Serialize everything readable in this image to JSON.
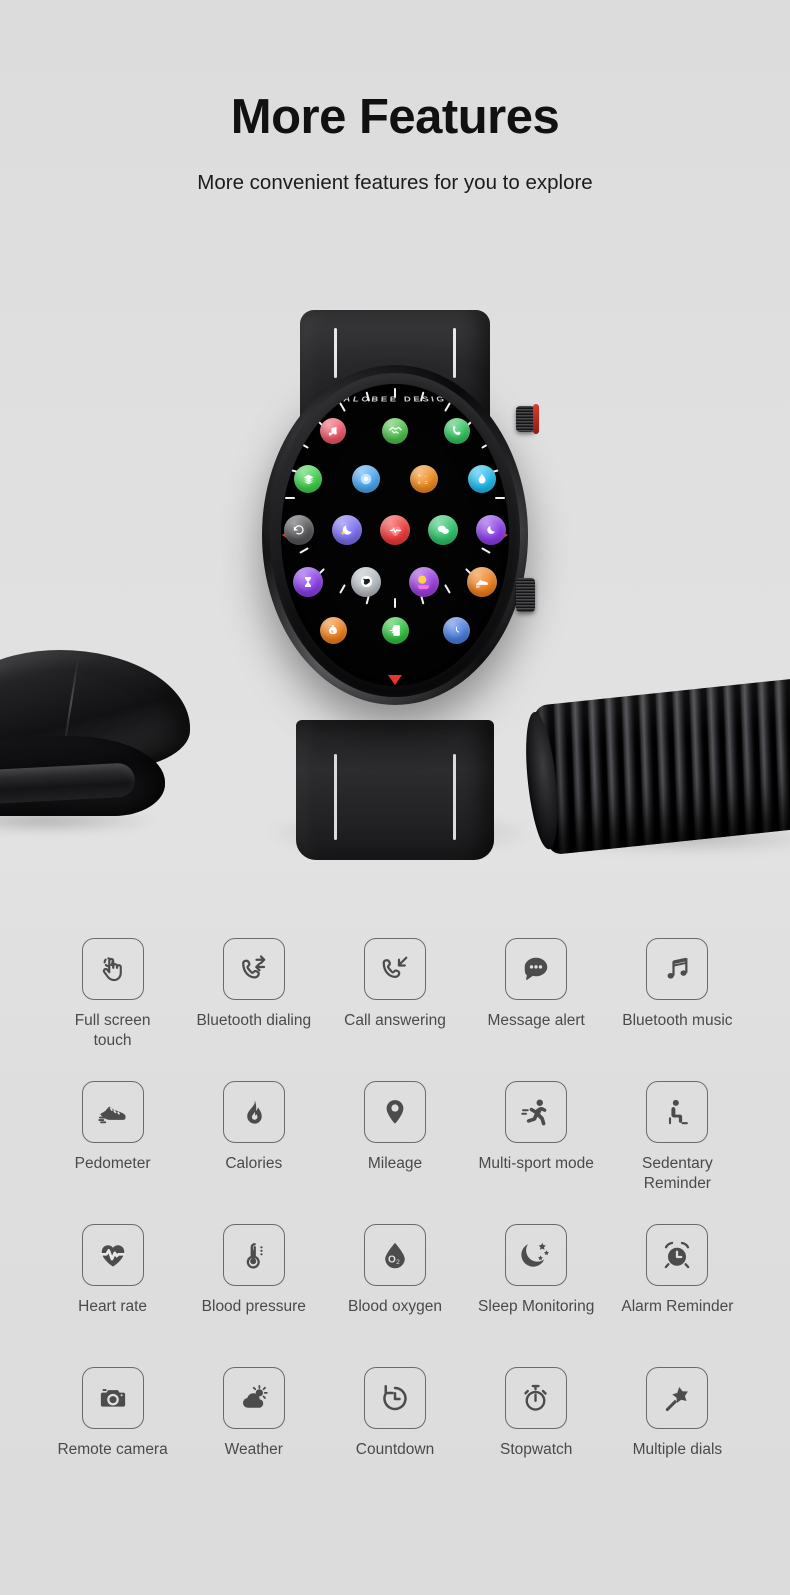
{
  "header": {
    "title": "More Features",
    "subtitle": "More convenient features for you to explore"
  },
  "product": {
    "brand_text": "KALOBEE DESIGN",
    "watch_apps": [
      {
        "name": "music-app-icon",
        "color": "#f0576b"
      },
      {
        "name": "handshake-app-icon",
        "color": "#4cc24c"
      },
      {
        "name": "phone-app-icon",
        "color": "#31c55e"
      },
      {
        "name": "layers-app-icon",
        "color": "#3ed14a"
      },
      {
        "name": "camera-ring-app-icon",
        "color": "#4aa8f0"
      },
      {
        "name": "calculator-app-icon",
        "color": "#f08a1e"
      },
      {
        "name": "water-drop-app-icon",
        "color": "#1fbcf0"
      },
      {
        "name": "refresh-app-icon",
        "color": "#555558"
      },
      {
        "name": "sleep-moon-app-icon",
        "color": "#7a6ef0"
      },
      {
        "name": "heart-rate-app-icon",
        "color": "#f03a3a"
      },
      {
        "name": "message-app-icon",
        "color": "#2fc46a"
      },
      {
        "name": "moon-purple-app-icon",
        "color": "#8a3ee8"
      },
      {
        "name": "hourglass-app-icon",
        "color": "#8a3ee8"
      },
      {
        "name": "world-app-icon",
        "color": "#b9bec4"
      },
      {
        "name": "gallery-app-icon",
        "color": "#9b3ee0"
      },
      {
        "name": "shoe-app-icon",
        "color": "#f0801e"
      },
      {
        "name": "wallet-app-icon",
        "color": "#f0801e"
      },
      {
        "name": "transfer-app-icon",
        "color": "#2fc43e"
      },
      {
        "name": "clock-app-icon",
        "color": "#4a7ee0"
      }
    ],
    "scene_objects": [
      {
        "name": "black-mouse-object"
      },
      {
        "name": "coiled-tube-object"
      }
    ]
  },
  "features": [
    {
      "icon": "full-screen-touch-icon",
      "label": "Full screen touch"
    },
    {
      "icon": "bluetooth-dialing-icon",
      "label": "Bluetooth dialing"
    },
    {
      "icon": "call-answering-icon",
      "label": "Call answering"
    },
    {
      "icon": "message-alert-icon",
      "label": "Message alert"
    },
    {
      "icon": "bluetooth-music-icon",
      "label": "Bluetooth music"
    },
    {
      "icon": "pedometer-icon",
      "label": "Pedometer"
    },
    {
      "icon": "calories-icon",
      "label": "Calories"
    },
    {
      "icon": "mileage-icon",
      "label": "Mileage"
    },
    {
      "icon": "multi-sport-mode-icon",
      "label": "Multi-sport mode"
    },
    {
      "icon": "sedentary-reminder-icon",
      "label": "Sedentary Reminder"
    },
    {
      "icon": "heart-rate-icon",
      "label": "Heart rate"
    },
    {
      "icon": "blood-pressure-icon",
      "label": "Blood pressure"
    },
    {
      "icon": "blood-oxygen-icon",
      "label": "Blood oxygen"
    },
    {
      "icon": "sleep-monitoring-icon",
      "label": "Sleep Monitoring"
    },
    {
      "icon": "alarm-reminder-icon",
      "label": "Alarm Reminder"
    },
    {
      "icon": "remote-camera-icon",
      "label": "Remote camera"
    },
    {
      "icon": "weather-icon",
      "label": "Weather"
    },
    {
      "icon": "countdown-icon",
      "label": "Countdown"
    },
    {
      "icon": "stopwatch-icon",
      "label": "Stopwatch"
    },
    {
      "icon": "multiple-dials-icon",
      "label": "Multiple dials"
    }
  ],
  "colors": {
    "background": "#dedede",
    "title": "#111111",
    "label": "#4a4a4a",
    "icon_stroke": "#6b6b6b",
    "accent_red": "#e8372a"
  }
}
